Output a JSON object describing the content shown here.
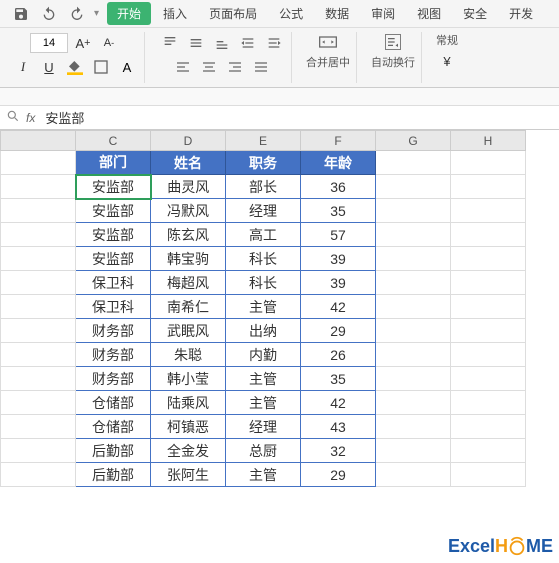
{
  "qat": {
    "dropdown": "▾"
  },
  "tabs": {
    "start": "开始",
    "insert": "插入",
    "layout": "页面布局",
    "formula": "公式",
    "data": "数据",
    "review": "审阅",
    "view": "视图",
    "security": "安全",
    "dev": "开发"
  },
  "ribbon": {
    "fontsize": "14",
    "merge": "合并居中",
    "wrap": "自动换行",
    "cur": "常规"
  },
  "formula": {
    "label": "fx",
    "value": "安监部"
  },
  "cols": [
    "C",
    "D",
    "E",
    "F",
    "G",
    "H"
  ],
  "headers": {
    "dept": "部门",
    "name": "姓名",
    "title": "职务",
    "age": "年龄"
  },
  "rows": [
    {
      "dept": "安监部",
      "name": "曲灵风",
      "title": "部长",
      "age": "36"
    },
    {
      "dept": "安监部",
      "name": "冯默风",
      "title": "经理",
      "age": "35"
    },
    {
      "dept": "安监部",
      "name": "陈玄风",
      "title": "高工",
      "age": "57"
    },
    {
      "dept": "安监部",
      "name": "韩宝驹",
      "title": "科长",
      "age": "39"
    },
    {
      "dept": "保卫科",
      "name": "梅超风",
      "title": "科长",
      "age": "39"
    },
    {
      "dept": "保卫科",
      "name": "南希仁",
      "title": "主管",
      "age": "42"
    },
    {
      "dept": "财务部",
      "name": "武眠风",
      "title": "出纳",
      "age": "29"
    },
    {
      "dept": "财务部",
      "name": "朱聪",
      "title": "内勤",
      "age": "26"
    },
    {
      "dept": "财务部",
      "name": "韩小莹",
      "title": "主管",
      "age": "35"
    },
    {
      "dept": "仓储部",
      "name": "陆乘风",
      "title": "主管",
      "age": "42"
    },
    {
      "dept": "仓储部",
      "name": "柯镇恶",
      "title": "经理",
      "age": "43"
    },
    {
      "dept": "后勤部",
      "name": "全金发",
      "title": "总厨",
      "age": "32"
    },
    {
      "dept": "后勤部",
      "name": "张阿生",
      "title": "主管",
      "age": "29"
    }
  ],
  "logo": {
    "p1": "Excel",
    "p2": "H",
    "p3": "ME"
  }
}
